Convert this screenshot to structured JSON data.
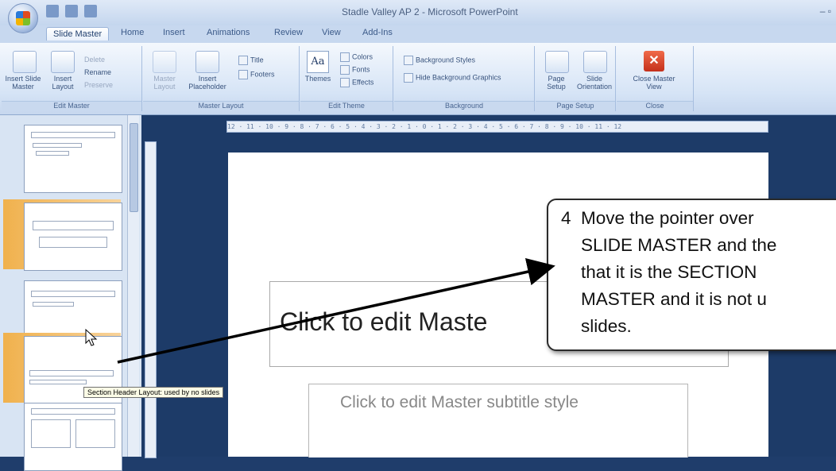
{
  "window": {
    "title": "Stadle Valley AP 2 - Microsoft PowerPoint"
  },
  "tabs": [
    {
      "label": "Slide Master",
      "active": true
    },
    {
      "label": "Home"
    },
    {
      "label": "Insert"
    },
    {
      "label": "Animations"
    },
    {
      "label": "Review"
    },
    {
      "label": "View"
    },
    {
      "label": "Add-Ins"
    }
  ],
  "ribbon": {
    "edit_master": {
      "label": "Edit Master",
      "insert_slide_master": "Insert Slide Master",
      "insert_layout": "Insert Layout",
      "delete": "Delete",
      "rename": "Rename",
      "preserve": "Preserve"
    },
    "master_layout": {
      "label": "Master Layout",
      "master_layout_btn": "Master Layout",
      "insert_placeholder": "Insert Placeholder",
      "title": "Title",
      "footers": "Footers"
    },
    "edit_theme": {
      "label": "Edit Theme",
      "themes": "Themes",
      "colors": "Colors",
      "fonts": "Fonts",
      "effects": "Effects"
    },
    "background": {
      "label": "Background",
      "background_styles": "Background Styles",
      "hide_bg_graphics": "Hide Background Graphics"
    },
    "page_setup": {
      "label": "Page Setup",
      "page_setup_btn": "Page Setup",
      "slide_orientation": "Slide Orientation"
    },
    "close": {
      "label": "Close",
      "close_master_view": "Close Master View"
    }
  },
  "tooltip": "Section Header Layout: used by no slides",
  "slide": {
    "title_placeholder": "Click to edit Maste",
    "subtitle_placeholder": "Click to edit Master subtitle style"
  },
  "callout": {
    "text": "4  Move the pointer over\n    SLIDE MASTER and the\n    that it is the SECTION \n    MASTER and it is not u\n    slides."
  },
  "ruler_text": "12 · 11 · 10 · 9 · 8 · 7 · 6 · 5 · 4 · 3 · 2 · 1 · 0 · 1 · 2 · 3 · 4 · 5 · 6 · 7 · 8 · 9 · 10 · 11 · 12",
  "colors": {
    "accent_orange": "#f0b14d",
    "workspace": "#1d3b68",
    "ribbon": "#d6e4f6"
  }
}
